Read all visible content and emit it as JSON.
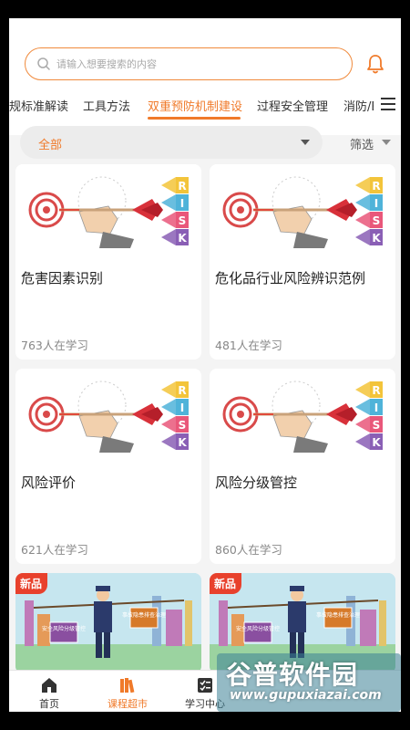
{
  "search": {
    "placeholder": "请输入想要搜索的内容",
    "icon": "search-icon"
  },
  "header": {
    "bell_icon": "bell-icon"
  },
  "tabs": [
    {
      "label": "规标准解读",
      "active": false
    },
    {
      "label": "工具方法",
      "active": false
    },
    {
      "label": "双重预防机制建设",
      "active": true
    },
    {
      "label": "过程安全管理",
      "active": false
    },
    {
      "label": "消防/E",
      "active": false
    }
  ],
  "filter": {
    "selected": "全部",
    "screen_label": "筛选"
  },
  "courses": [
    {
      "title": "危害因素识别",
      "learners": "763人在学习",
      "image": "risk-dart-illustration"
    },
    {
      "title": "危化品行业风险辨识范例",
      "learners": "481人在学习",
      "image": "risk-dart-illustration"
    },
    {
      "title": "风险评价",
      "learners": "621人在学习",
      "image": "risk-dart-illustration"
    },
    {
      "title": "风险分级管控",
      "learners": "860人在学习",
      "image": "risk-dart-illustration"
    }
  ],
  "risk_letters": [
    "R",
    "I",
    "S",
    "K"
  ],
  "new_courses": [
    {
      "badge": "新品",
      "sign_left": "安全风险分级管控",
      "sign_right": "事故隐患排查治理"
    },
    {
      "badge": "新品",
      "sign_left": "安全风险分级管控",
      "sign_right": "事故隐患排查治理"
    }
  ],
  "bottom_nav": [
    {
      "label": "首页",
      "icon": "home-icon",
      "active": false
    },
    {
      "label": "课程超市",
      "icon": "books-icon",
      "active": true
    },
    {
      "label": "学习中心",
      "icon": "checklist-icon",
      "active": false
    }
  ],
  "watermark": {
    "title": "谷普软件园",
    "url": "www.gupuxiazai.com"
  },
  "colors": {
    "accent": "#f07a2a",
    "search_border": "#f08a3c",
    "badge": "#e8412c"
  }
}
